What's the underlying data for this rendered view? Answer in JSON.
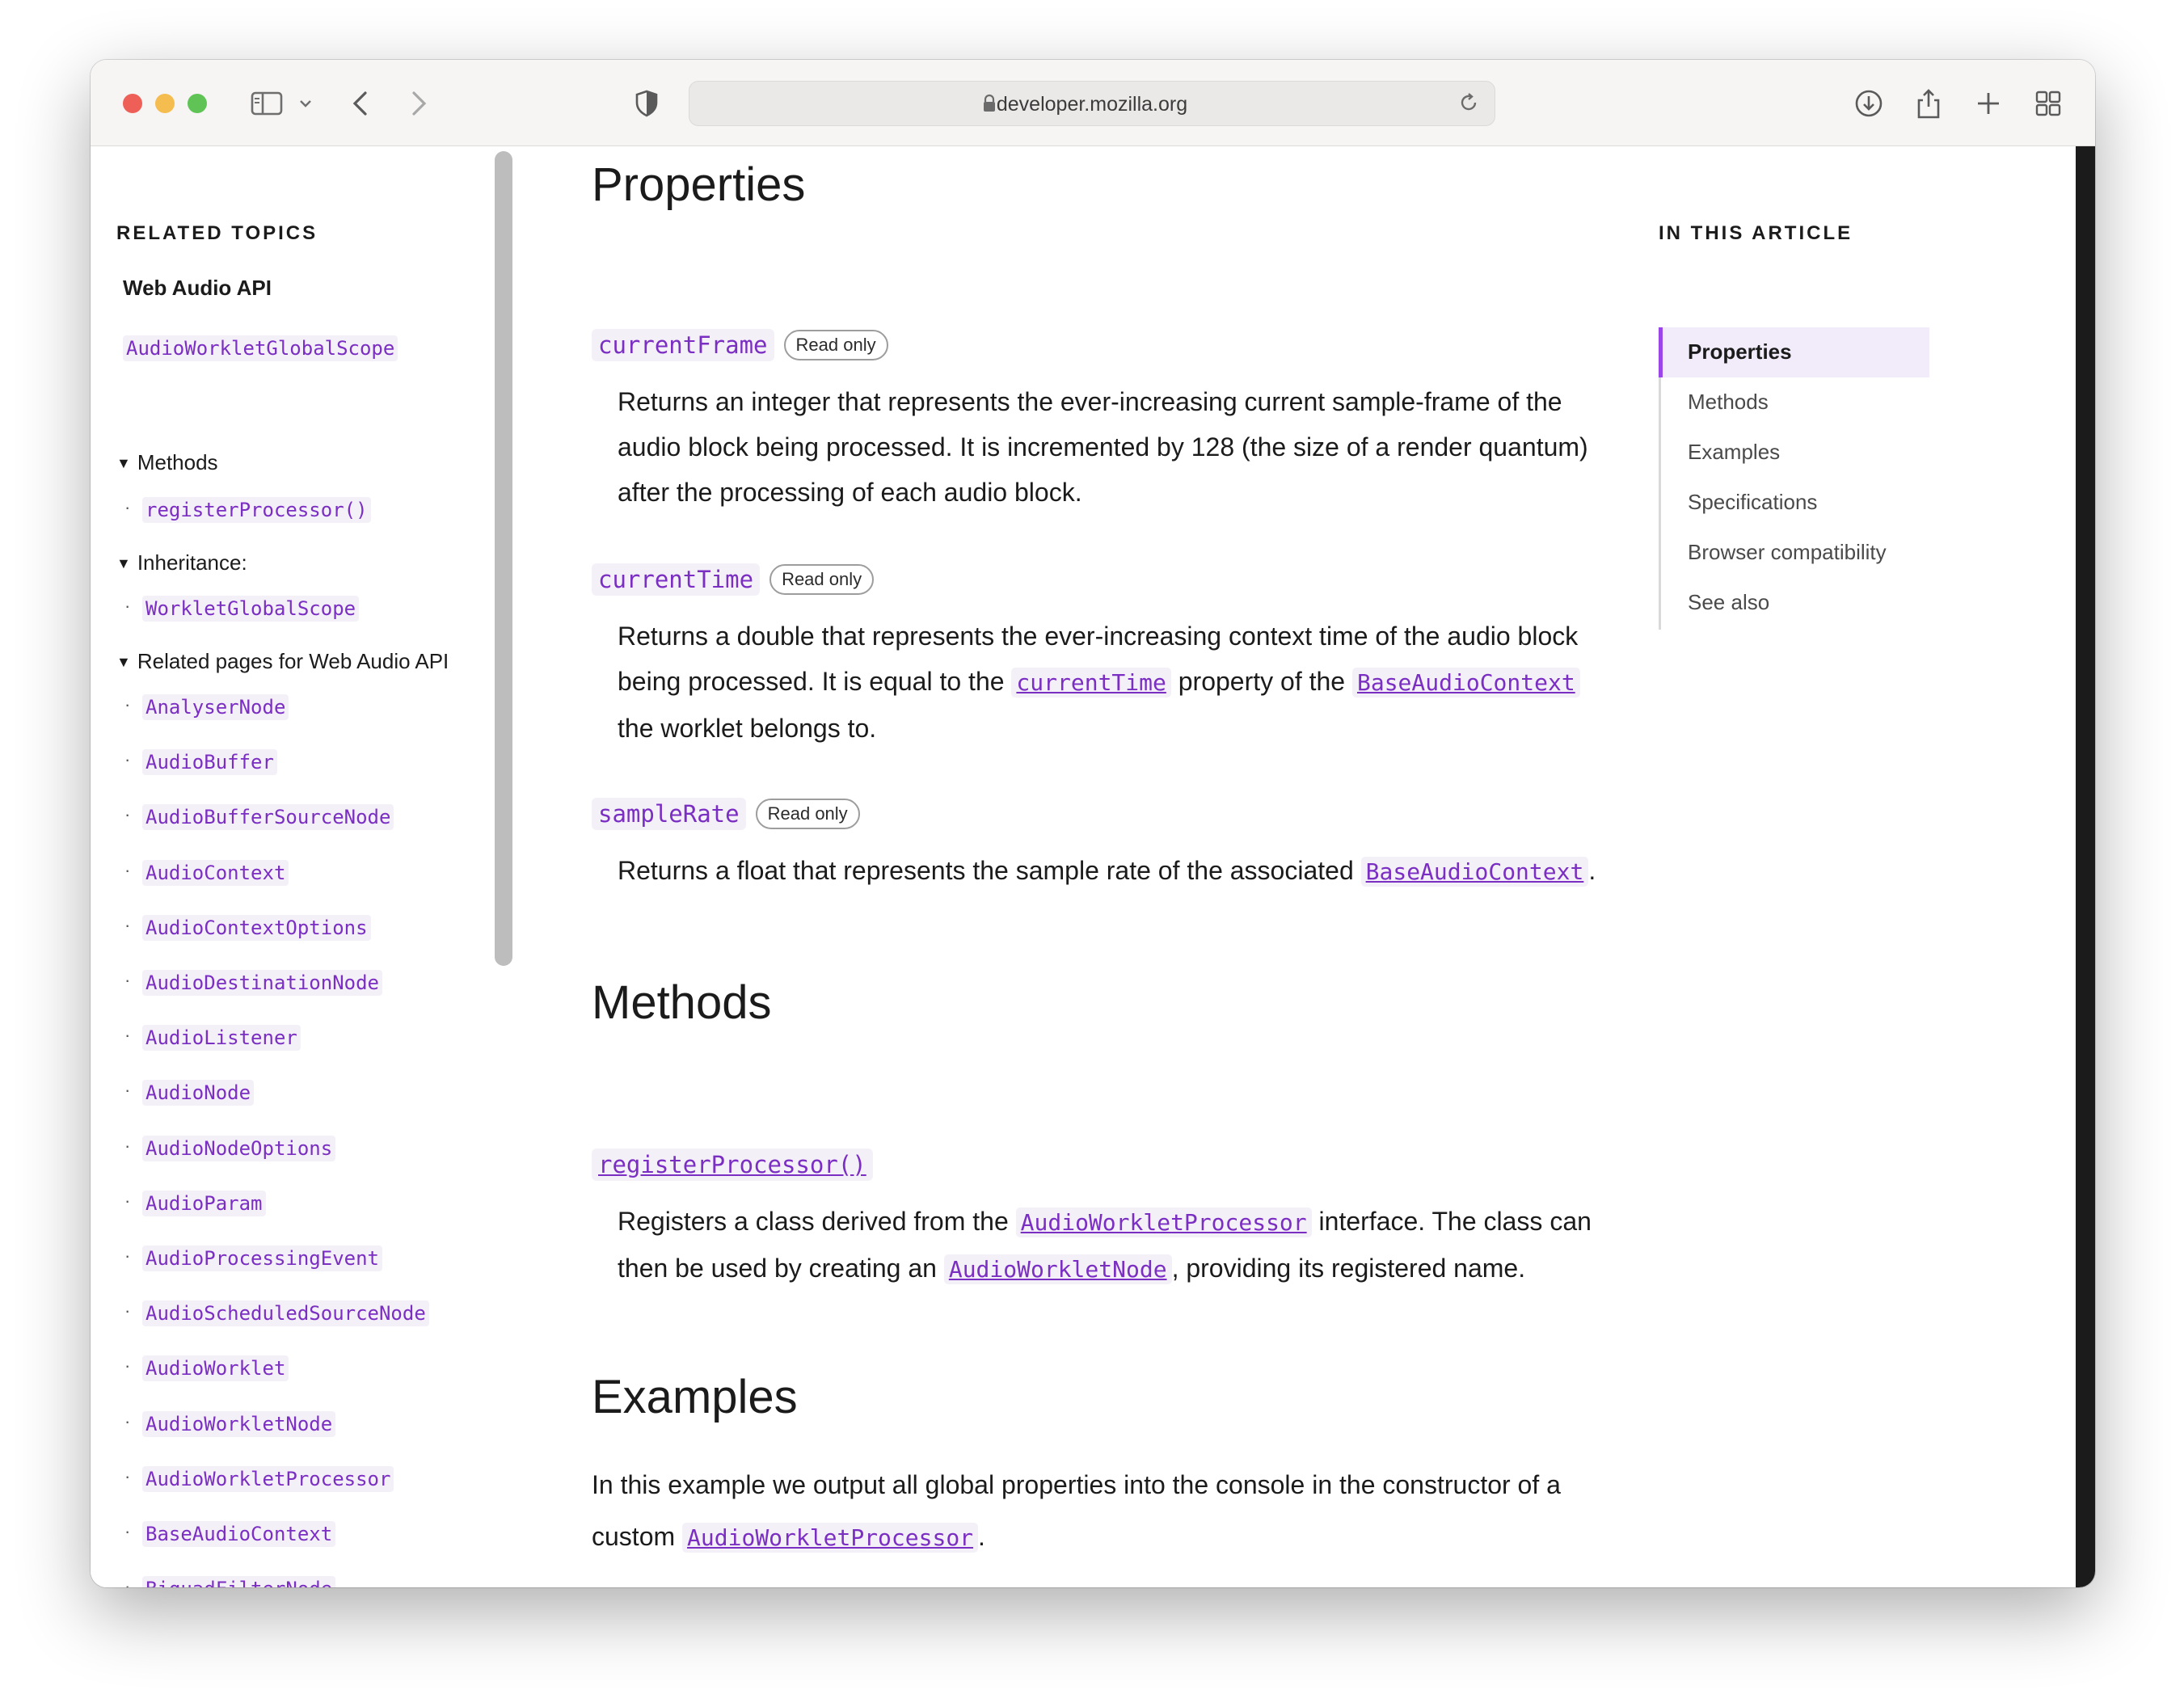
{
  "browser": {
    "address": "developer.mozilla.org"
  },
  "sidebar": {
    "title": "RELATED TOPICS",
    "api": "Web Audio API",
    "scope": "AudioWorkletGlobalScope",
    "methods_label": "Methods",
    "methods": [
      "registerProcessor()"
    ],
    "inheritance_label": "Inheritance:",
    "inheritance": [
      "WorkletGlobalScope"
    ],
    "related_label": "Related pages for Web Audio API",
    "related": [
      "AnalyserNode",
      "AudioBuffer",
      "AudioBufferSourceNode",
      "AudioContext",
      "AudioContextOptions",
      "AudioDestinationNode",
      "AudioListener",
      "AudioNode",
      "AudioNodeOptions",
      "AudioParam",
      "AudioProcessingEvent",
      "AudioScheduledSourceNode",
      "AudioWorklet",
      "AudioWorkletNode",
      "AudioWorkletProcessor",
      "BaseAudioContext",
      "BiquadFilterNode"
    ]
  },
  "main": {
    "properties_heading": "Properties",
    "props": [
      {
        "name": "currentFrame",
        "badge": "Read only",
        "desc": "Returns an integer that represents the ever-increasing current sample-frame of the audio block being processed. It is incremented by 128 (the size of a render quantum) after the processing of each audio block."
      },
      {
        "name": "currentTime",
        "badge": "Read only",
        "desc_a": "Returns a double that represents the ever-increasing context time of the audio block being processed. It is equal to the ",
        "desc_link1": "currentTime",
        "desc_b": " property of the ",
        "desc_link2": "BaseAudioContext",
        "desc_c": " the worklet belongs to."
      },
      {
        "name": "sampleRate",
        "badge": "Read only",
        "desc_a": "Returns a float that represents the sample rate of the associated ",
        "desc_link": "BaseAudioContext",
        "desc_b": "."
      }
    ],
    "methods_heading": "Methods",
    "method": {
      "name": "registerProcessor()",
      "desc_a": "Registers a class derived from the ",
      "desc_link1": "AudioWorkletProcessor",
      "desc_b": " interface. The class can then be used by creating an ",
      "desc_link2": "AudioWorkletNode",
      "desc_c": ", providing its registered name."
    },
    "examples_heading": "Examples",
    "examples_a": "In this example we output all global properties into the console in the constructor of a custom ",
    "examples_link": "AudioWorkletProcessor",
    "examples_b": "."
  },
  "toc": {
    "title": "IN THIS ARTICLE",
    "items": [
      "Properties",
      "Methods",
      "Examples",
      "Specifications",
      "Browser compatibility",
      "See also"
    ]
  }
}
